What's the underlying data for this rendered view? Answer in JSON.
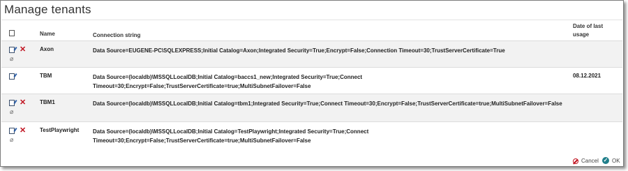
{
  "dialog": {
    "title": "Manage tenants"
  },
  "table": {
    "headers": {
      "name": "Name",
      "connection": "Connection string",
      "date_line1": "Date of last",
      "date_line2": "usage"
    },
    "rows": [
      {
        "name": "Axon",
        "conn1": "Data Source=EUGENE-PC\\SQLEXPRESS;Initial Catalog=Axon;Integrated Security=True;Encrypt=False;Connection Timeout=30;TrustServerCertificate=True",
        "conn2": "",
        "date": ""
      },
      {
        "name": "TBM",
        "conn1": "Data Source=(localdb)\\MSSQLLocalDB;Initial Catalog=baccs1_new;Integrated Security=True;Connect",
        "conn2": "Timeout=30;Encrypt=False;TrustServerCertificate=true;MultiSubnetFailover=False",
        "date": "08.12.2021"
      },
      {
        "name": "TBM1",
        "conn1": "Data Source=(localdb)\\MSSQLLocalDB;Initial Catalog=tbm1;Integrated Security=True;Connect Timeout=30;Encrypt=False;TrustServerCertificate=true;MultiSubnetFailover=False",
        "conn2": "",
        "date": ""
      },
      {
        "name": "TestPlaywright",
        "conn1": "Data Source=(localdb)\\MSSQLLocalDB;Initial Catalog=TestPlaywright;Integrated Security=True;Connect",
        "conn2": "Timeout=30;Encrypt=False;TrustServerCertificate=true;MultiSubnetFailover=False",
        "date": ""
      }
    ]
  },
  "footer": {
    "cancel_label": "Cancel",
    "ok_label": "OK"
  },
  "icons": {
    "add": "new-page-icon",
    "edit": "edit-icon",
    "delete": "delete-x-icon",
    "attach": "paperclip-icon",
    "cancel": "cancel-circle-icon",
    "ok": "check-circle-icon"
  },
  "colors": {
    "delete": "#c0121f",
    "ok": "#1f7e8a",
    "alt_row": "#f2f2f2"
  }
}
